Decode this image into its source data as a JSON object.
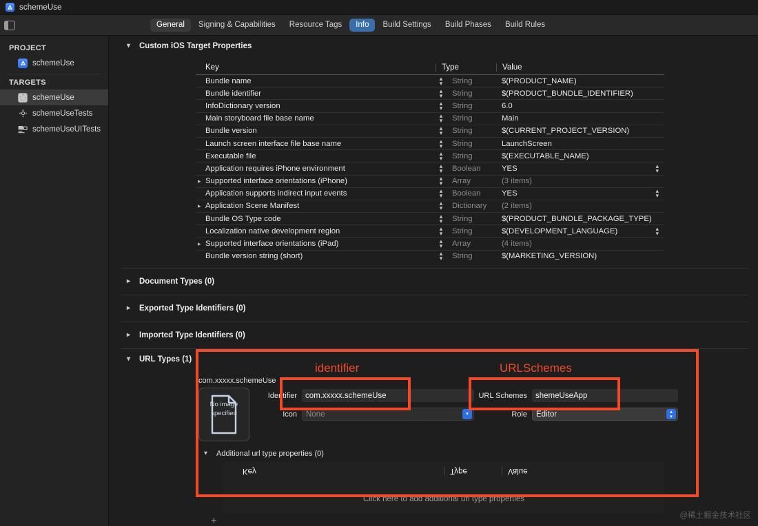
{
  "window": {
    "title": "schemeUse",
    "app_icon": "xcode-project-icon"
  },
  "tabbar": {
    "sidebar_toggle_icon": "left-panel-toggle-icon",
    "tabs": [
      {
        "label": "General",
        "state": "hovered"
      },
      {
        "label": "Signing & Capabilities",
        "state": "normal"
      },
      {
        "label": "Resource Tags",
        "state": "normal"
      },
      {
        "label": "Info",
        "state": "selected"
      },
      {
        "label": "Build Settings",
        "state": "normal"
      },
      {
        "label": "Build Phases",
        "state": "normal"
      },
      {
        "label": "Build Rules",
        "state": "normal"
      }
    ]
  },
  "sidebar": {
    "project_group": "PROJECT",
    "project_items": [
      {
        "label": "schemeUse",
        "icon": "xcode-project-icon"
      }
    ],
    "targets_group": "TARGETS",
    "target_items": [
      {
        "label": "schemeUse",
        "icon": "app-target-icon",
        "selected": true
      },
      {
        "label": "schemeUseTests",
        "icon": "unit-test-target-icon",
        "selected": false
      },
      {
        "label": "schemeUseUITests",
        "icon": "ui-test-target-icon",
        "selected": false
      }
    ]
  },
  "main": {
    "custom_properties": {
      "title": "Custom iOS Target Properties",
      "expanded": true,
      "columns": {
        "key": "Key",
        "type": "Type",
        "value": "Value"
      },
      "rows": [
        {
          "key": "Bundle name",
          "type": "String",
          "value": "$(PRODUCT_NAME)",
          "expandable": false,
          "value_stepper": false
        },
        {
          "key": "Bundle identifier",
          "type": "String",
          "value": "$(PRODUCT_BUNDLE_IDENTIFIER)",
          "expandable": false,
          "value_stepper": false
        },
        {
          "key": "InfoDictionary version",
          "type": "String",
          "value": "6.0",
          "expandable": false,
          "value_stepper": false
        },
        {
          "key": "Main storyboard file base name",
          "type": "String",
          "value": "Main",
          "expandable": false,
          "value_stepper": false
        },
        {
          "key": "Bundle version",
          "type": "String",
          "value": "$(CURRENT_PROJECT_VERSION)",
          "expandable": false,
          "value_stepper": false
        },
        {
          "key": "Launch screen interface file base name",
          "type": "String",
          "value": "LaunchScreen",
          "expandable": false,
          "value_stepper": false
        },
        {
          "key": "Executable file",
          "type": "String",
          "value": "$(EXECUTABLE_NAME)",
          "expandable": false,
          "value_stepper": false
        },
        {
          "key": "Application requires iPhone environment",
          "type": "Boolean",
          "value": "YES",
          "expandable": false,
          "value_stepper": true
        },
        {
          "key": "Supported interface orientations (iPhone)",
          "type": "Array",
          "value": "(3 items)",
          "expandable": true,
          "value_stepper": false,
          "dim_value": true
        },
        {
          "key": "Application supports indirect input events",
          "type": "Boolean",
          "value": "YES",
          "expandable": false,
          "value_stepper": true
        },
        {
          "key": "Application Scene Manifest",
          "type": "Dictionary",
          "value": "(2 items)",
          "expandable": true,
          "value_stepper": false,
          "dim_value": true
        },
        {
          "key": "Bundle OS Type code",
          "type": "String",
          "value": "$(PRODUCT_BUNDLE_PACKAGE_TYPE)",
          "expandable": false,
          "value_stepper": false
        },
        {
          "key": "Localization native development region",
          "type": "String",
          "value": "$(DEVELOPMENT_LANGUAGE)",
          "expandable": false,
          "value_stepper": true
        },
        {
          "key": "Supported interface orientations (iPad)",
          "type": "Array",
          "value": "(4 items)",
          "expandable": true,
          "value_stepper": false,
          "dim_value": true
        },
        {
          "key": "Bundle version string (short)",
          "type": "String",
          "value": "$(MARKETING_VERSION)",
          "expandable": false,
          "value_stepper": false
        }
      ]
    },
    "collapsed_sections": [
      {
        "title": "Document Types (0)",
        "expanded": false
      },
      {
        "title": "Exported Type Identifiers (0)",
        "expanded": false
      },
      {
        "title": "Imported Type Identifiers (0)",
        "expanded": false
      }
    ],
    "url_types": {
      "title": "URL Types (1)",
      "expanded": true,
      "entry_label": "com.xxxxx.schemeUse",
      "icon_well_text": "No image specified",
      "identifier_label": "Identifier",
      "identifier_value": "com.xxxxx.schemeUse",
      "icon_label": "Icon",
      "icon_placeholder": "None",
      "url_schemes_label": "URL Schemes",
      "url_schemes_value": "shemeUseApp",
      "role_label": "Role",
      "role_value": "Editor",
      "additional_title": "Additional url type properties (0)",
      "additional_columns": {
        "key": "Key",
        "type": "Type",
        "value": "Value"
      },
      "additional_hint": "Click here to add additional url type properties"
    },
    "add_button": "+"
  },
  "annotations": {
    "color": "#f04a2a",
    "identifier_callout": "identifier",
    "urlschemes_callout": "URLSchemes"
  },
  "watermark": "@稀土掘金技术社区"
}
